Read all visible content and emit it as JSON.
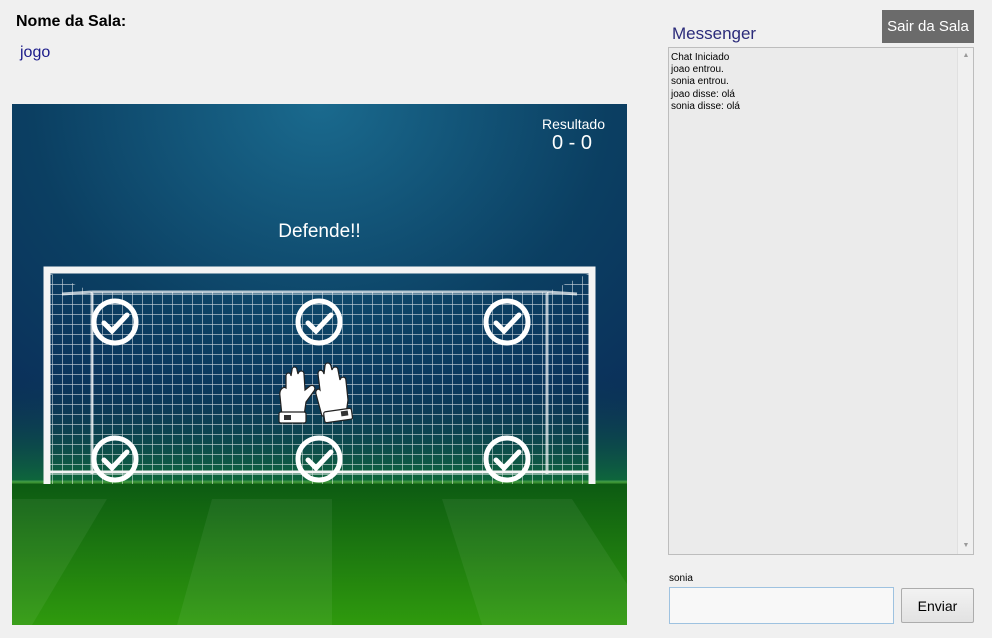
{
  "room": {
    "label": "Nome da Sala:",
    "name": "jogo"
  },
  "game": {
    "score_label": "Resultado",
    "score": "0 - 0",
    "message": "Defende!!"
  },
  "messenger": {
    "title": "Messenger",
    "exit_button": "Sair da Sala",
    "lines": [
      "Chat Iniciado",
      "joao entrou.",
      "sonia entrou.",
      "joao disse: olá",
      "sonia disse: olá"
    ],
    "user": "sonia",
    "input_value": "",
    "send_button": "Enviar"
  },
  "icons": {
    "target": "check-circle-icon",
    "goalkeeper": "goalkeeper-gloves-icon",
    "scroll_up": "scroll-up-arrow-icon",
    "scroll_down": "scroll-down-arrow-icon"
  },
  "colors": {
    "sky_top": "#0b3f62",
    "sky_bottom": "#0b2b58",
    "grass": "#2f9a0d",
    "exit_button_bg": "#6b6b6b",
    "room_name": "#1a1a8a",
    "messenger_title": "#2b2b7a"
  }
}
